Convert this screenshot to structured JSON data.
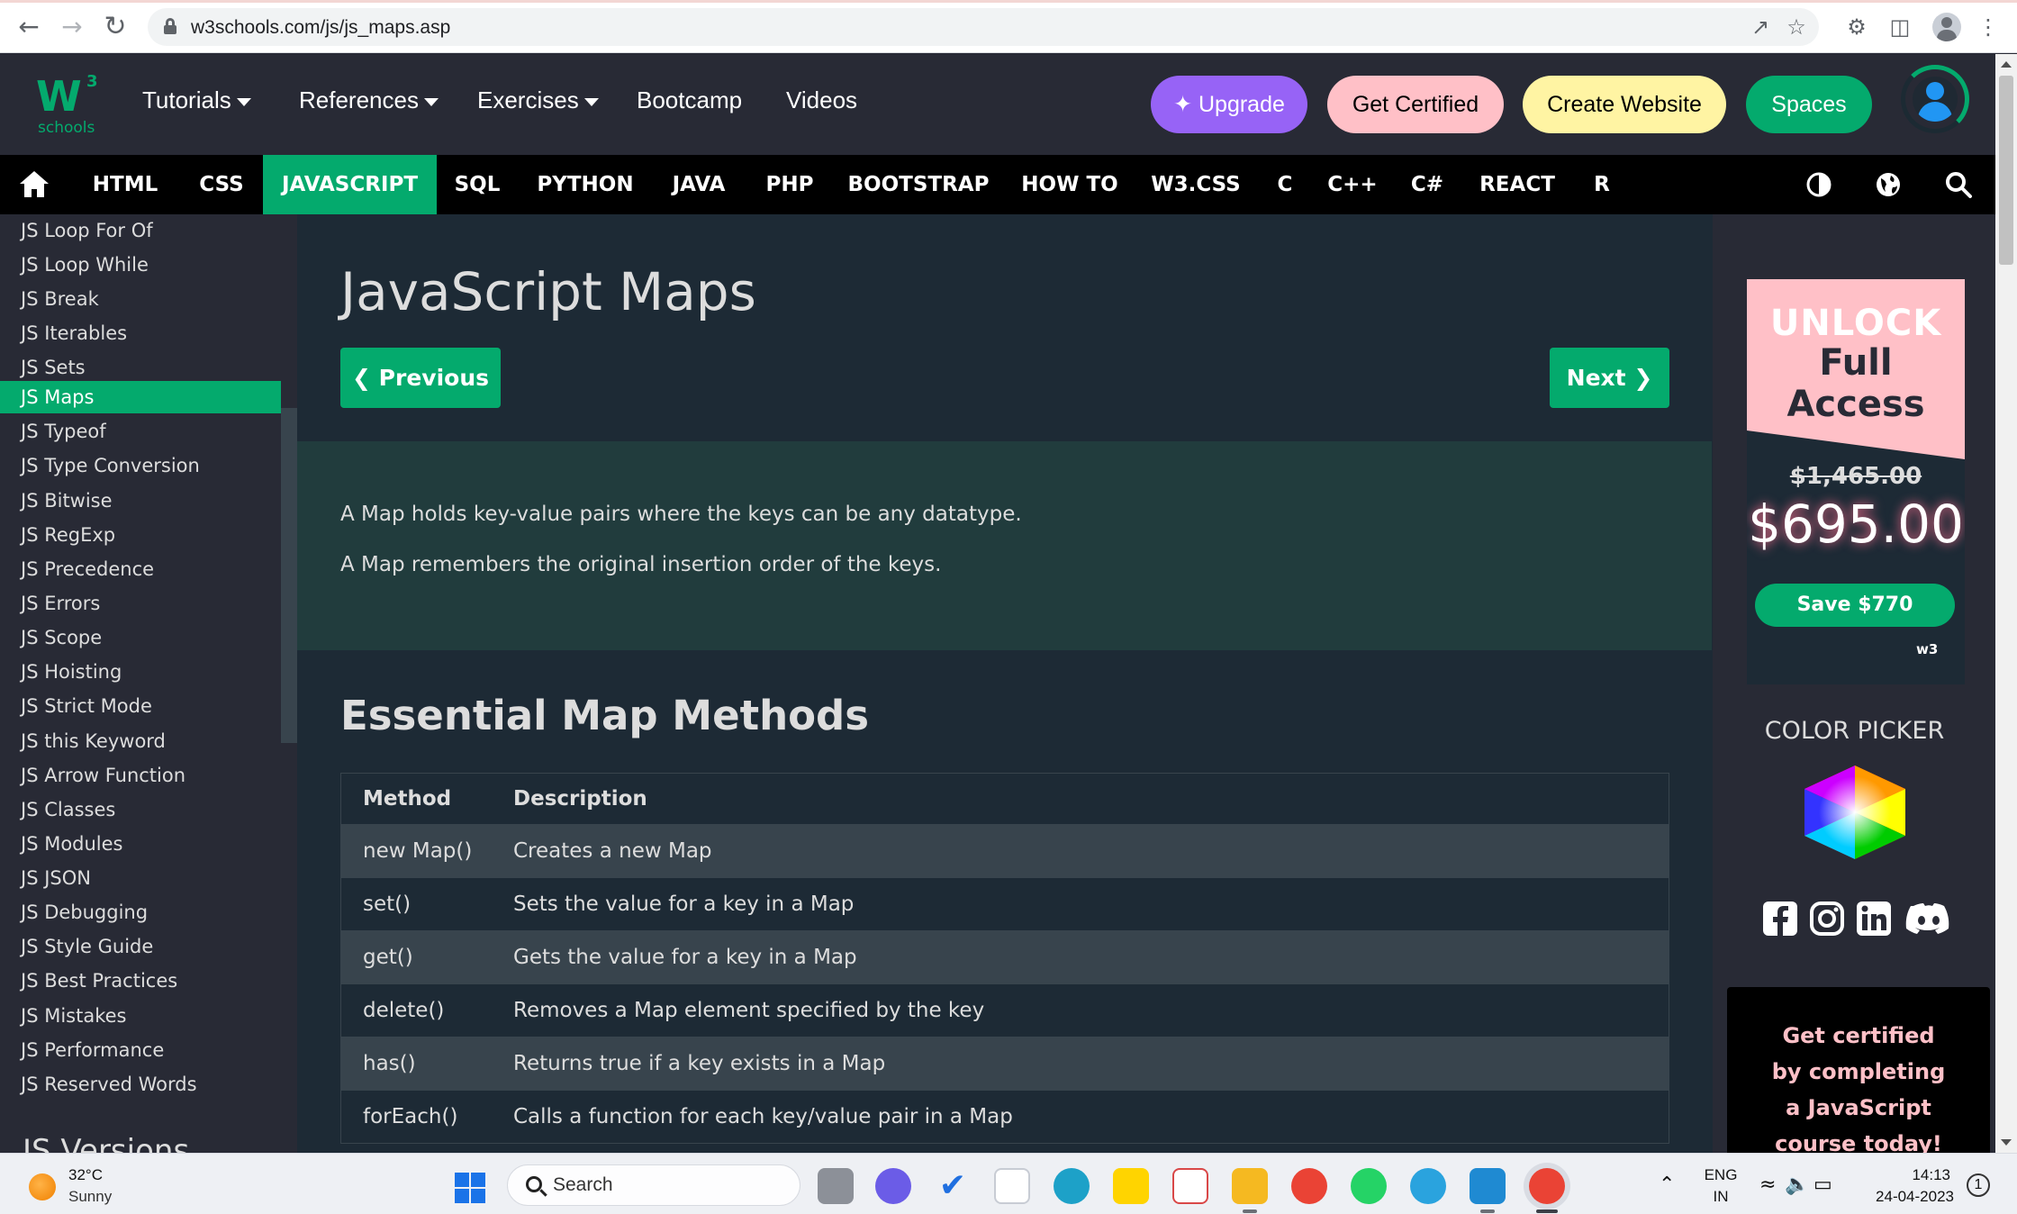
{
  "browser": {
    "url": "w3schools.com/js/js_maps.asp"
  },
  "topnav": {
    "logo_superscript": "3",
    "logo_text": "schools",
    "links": [
      "Tutorials",
      "References",
      "Exercises",
      "Bootcamp",
      "Videos"
    ],
    "buttons": {
      "upgrade": "Upgrade",
      "get_certified": "Get Certified",
      "create_website": "Create Website",
      "spaces": "Spaces"
    },
    "colors": {
      "brand_green": "#04aa6d",
      "upgrade_purple": "#9763f6",
      "certified_pink": "#ffc0c7",
      "website_yellow": "#fff4a3"
    }
  },
  "subnav": {
    "items": [
      "HTML",
      "CSS",
      "JAVASCRIPT",
      "SQL",
      "PYTHON",
      "JAVA",
      "PHP",
      "BOOTSTRAP",
      "HOW TO",
      "W3.CSS",
      "C",
      "C++",
      "C#",
      "REACT",
      "R"
    ],
    "active": "JAVASCRIPT",
    "icons": [
      "home-icon",
      "theme-toggle-icon",
      "globe-icon",
      "search-icon"
    ]
  },
  "sidebar": {
    "items": [
      "JS Loop For Of",
      "JS Loop While",
      "JS Break",
      "JS Iterables",
      "JS Sets",
      "JS Maps",
      "JS Typeof",
      "JS Type Conversion",
      "JS Bitwise",
      "JS RegExp",
      "JS Precedence",
      "JS Errors",
      "JS Scope",
      "JS Hoisting",
      "JS Strict Mode",
      "JS this Keyword",
      "JS Arrow Function",
      "JS Classes",
      "JS Modules",
      "JS JSON",
      "JS Debugging",
      "JS Style Guide",
      "JS Best Practices",
      "JS Mistakes",
      "JS Performance",
      "JS Reserved Words"
    ],
    "active": "JS Maps",
    "next_heading": "JS Versions"
  },
  "main": {
    "title": "JavaScript Maps",
    "prev_label": "Previous",
    "next_label": "Next",
    "intro": [
      "A Map holds key-value pairs where the keys can be any datatype.",
      "A Map remembers the original insertion order of the keys."
    ],
    "section_title": "Essential Map Methods",
    "table": {
      "headers": [
        "Method",
        "Description"
      ],
      "rows": [
        [
          "new Map()",
          "Creates a new Map"
        ],
        [
          "set()",
          "Sets the value for a key in a Map"
        ],
        [
          "get()",
          "Gets the value for a key in a Map"
        ],
        [
          "delete()",
          "Removes a Map element specified by the key"
        ],
        [
          "has()",
          "Returns true if a key exists in a Map"
        ],
        [
          "forEach()",
          "Calls a function for each key/value pair in a Map"
        ]
      ]
    }
  },
  "right": {
    "ad": {
      "line1": "UNLOCK",
      "line2": "Full Access",
      "old_price": "$1,465.00",
      "new_price": "$695.00",
      "save": "Save $770",
      "logo": "w3"
    },
    "color_picker_title": "COLOR PICKER",
    "social_icons": [
      "facebook-icon",
      "instagram-icon",
      "linkedin-icon",
      "discord-icon"
    ],
    "cert_lines": [
      "Get certified",
      "by completing",
      "a JavaScript",
      "course today!"
    ]
  },
  "taskbar": {
    "weather_temp": "32°C",
    "weather_desc": "Sunny",
    "search_label": "Search",
    "language": "ENG",
    "region": "IN",
    "time": "14:13",
    "date": "24-04-2023",
    "notifications": "1"
  }
}
